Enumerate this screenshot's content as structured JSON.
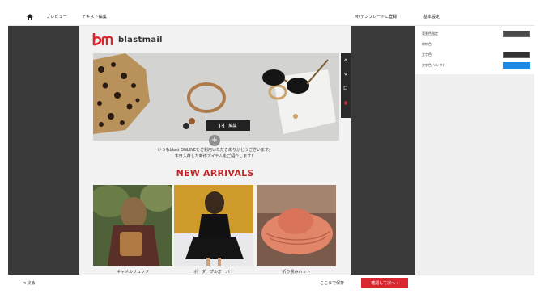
{
  "topbar": {
    "home_icon": "home-icon",
    "tabs": [
      {
        "label": "プレビュー"
      },
      {
        "label": "テキスト編集"
      }
    ],
    "mytemplate_label": "Myテンプレートに登録",
    "props_title": "基本設定"
  },
  "properties": {
    "rows": [
      {
        "label": "背景色指定",
        "color": "#4a4a4a"
      },
      {
        "label": "枠線色",
        "color": "#ffffff"
      },
      {
        "label": "文字色",
        "color": "#333333"
      },
      {
        "label": "文字色(リンク)",
        "color": "#1e88e5"
      }
    ]
  },
  "canvas": {
    "logo_text": "blastmail",
    "logo_color": "#d8272f",
    "edit_button_label": "編集",
    "plus_label": "+",
    "intro_line1": "いつもblast ONLINEをご利用いただきありがとうございます。",
    "intro_line2": "本日入荷した新作アイテムをご紹介します！",
    "heading": "NEW ARRIVALS",
    "heading_color": "#c0272d",
    "products": [
      {
        "caption": "キャメルリュック"
      },
      {
        "caption": "ボーダープルオーバー"
      },
      {
        "caption": "折り畳みハット"
      }
    ]
  },
  "bottombar": {
    "back_label": "< 戻る",
    "save_label": "ここまで保存",
    "next_label": "確認して次へ ›",
    "next_color": "#d8272f"
  }
}
